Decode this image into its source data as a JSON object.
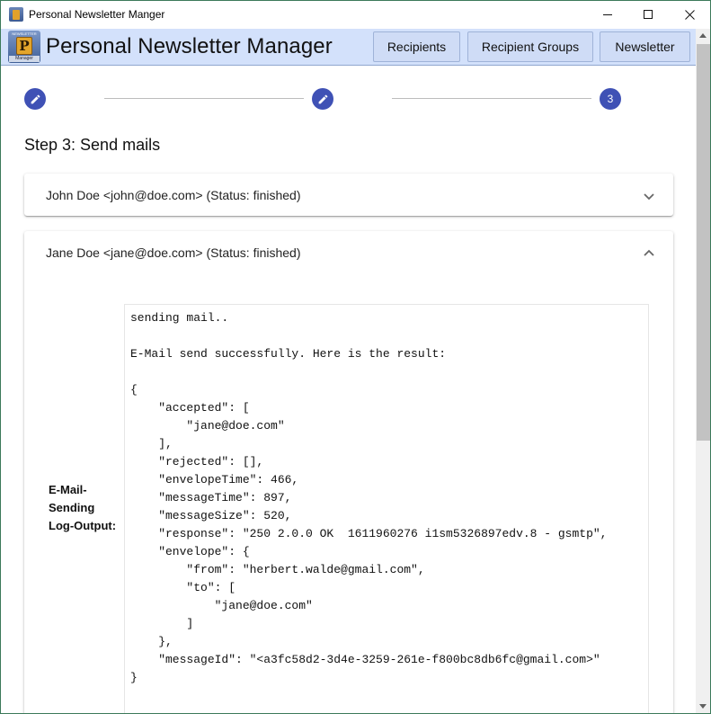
{
  "window": {
    "title": "Personal Newsletter Manger",
    "controls": {
      "minimize": "—",
      "maximize": "☐",
      "close": "✕"
    }
  },
  "app": {
    "title": "Personal Newsletter Manager",
    "logo": {
      "icon": "newsletter-logo-icon",
      "letter": "P",
      "top_text": "NEWSLETTER",
      "bottom_text": "Manager"
    },
    "nav": {
      "recipients": "Recipients",
      "recipient_groups": "Recipient Groups",
      "newsletter": "Newsletter"
    },
    "accent_color": "#3f51b5",
    "header_color": "#d3e1fb"
  },
  "stepper": {
    "steps": [
      {
        "icon": "pencil-icon",
        "label": ""
      },
      {
        "icon": "pencil-icon",
        "label": ""
      },
      {
        "icon": "",
        "label": "3"
      }
    ],
    "current_step": 3
  },
  "step_title": "Step 3: Send mails",
  "panels": [
    {
      "title": "John Doe <john@doe.com> (Status: finished)",
      "expanded": false,
      "icon": "chevron-down-icon"
    },
    {
      "title": "Jane Doe <jane@doe.com> (Status: finished)",
      "expanded": true,
      "icon": "chevron-up-icon"
    }
  ],
  "log": {
    "label_lines": [
      "E-Mail-",
      "Sending",
      "Log-Output:"
    ],
    "lines": [
      "sending mail..",
      "",
      "E-Mail send successfully. Here is the result:",
      "",
      "{",
      "    \"accepted\": [",
      "        \"jane@doe.com\"",
      "    ],",
      "    \"rejected\": [],",
      "    \"envelopeTime\": 466,",
      "    \"messageTime\": 897,",
      "    \"messageSize\": 520,",
      "    \"response\": \"250 2.0.0 OK  1611960276 i1sm5326897edv.8 - gsmtp\",",
      "    \"envelope\": {",
      "        \"from\": \"herbert.walde@gmail.com\",",
      "        \"to\": [",
      "            \"jane@doe.com\"",
      "        ]",
      "    },",
      "    \"messageId\": \"<a3fc58d2-3d4e-3259-261e-f800bc8db6fc@gmail.com>\"",
      "}"
    ]
  }
}
